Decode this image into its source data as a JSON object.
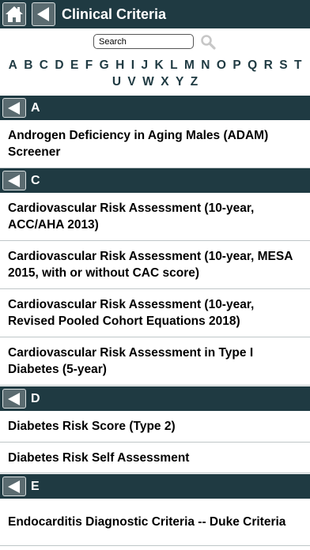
{
  "header": {
    "title": "Clinical Criteria",
    "home_icon": "home-icon",
    "back_icon": "back-arrow-icon"
  },
  "search": {
    "placeholder": "Search",
    "value": "",
    "icon": "magnifier-icon"
  },
  "alphabet": [
    "A",
    "B",
    "C",
    "D",
    "E",
    "F",
    "G",
    "H",
    "I",
    "J",
    "K",
    "L",
    "M",
    "N",
    "O",
    "P",
    "Q",
    "R",
    "S",
    "T",
    "U",
    "V",
    "W",
    "X",
    "Y",
    "Z"
  ],
  "sections": [
    {
      "letter": "A",
      "items": [
        "Androgen Deficiency in Aging Males (ADAM) Screener"
      ]
    },
    {
      "letter": "C",
      "items": [
        "Cardiovascular Risk Assessment (10-year, ACC/AHA 2013)",
        "Cardiovascular Risk Assessment (10-year, MESA 2015, with or without CAC score)",
        "Cardiovascular Risk Assessment (10-year, Revised Pooled Cohort Equations 2018)",
        "Cardiovascular Risk Assessment in Type I Diabetes (5-year)"
      ]
    },
    {
      "letter": "D",
      "items": [
        "Diabetes Risk Score (Type 2)",
        "Diabetes Risk Self Assessment"
      ]
    },
    {
      "letter": "E",
      "items": [
        "Endocarditis Diagnostic Criteria -- Duke Criteria"
      ]
    }
  ],
  "colors": {
    "bar": "#1f3a42",
    "button": "#5a6b70",
    "text": "#000000",
    "divider": "#bfc6c8"
  }
}
